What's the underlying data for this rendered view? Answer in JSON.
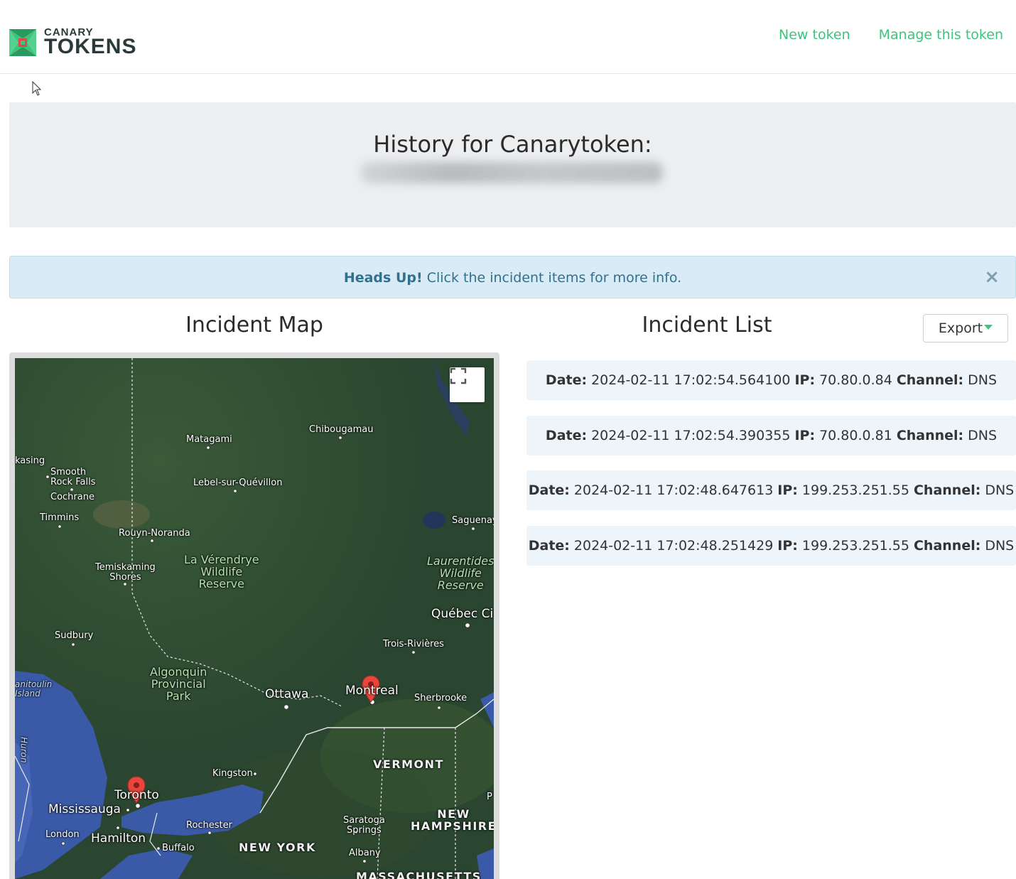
{
  "brand": {
    "small": "CANARY",
    "big": "TOKENS"
  },
  "nav": {
    "new_token": "New token",
    "manage_token": "Manage this token"
  },
  "jumbotron": {
    "title": "History for Canarytoken:"
  },
  "alert": {
    "strong": "Heads Up!",
    "text": "Click the incident items for more info.",
    "close": "×"
  },
  "map_section": {
    "heading": "Incident Map",
    "labels": {
      "kasing": "kasing",
      "smooth": "Smooth\nRock Falls",
      "cochrane": "Cochrane",
      "timmins": "Timmins",
      "matagami": "Matagami",
      "chibougamau": "Chibougamau",
      "lebel": "Lebel-sur-Quévillon",
      "saguenay": "Saguenay",
      "rouyn": "Rouyn-Noranda",
      "laverendrye": "La Vérendrye\nWildlife\nReserve",
      "temiskaming": "Temiskaming\nShores",
      "laurentides": "Laurentides\nWildlife\nReserve",
      "quebec": "Québec Ci",
      "sudbury": "Sudbury",
      "trois": "Trois-Rivières",
      "algonquin": "Algonquin\nProvincial\nPark",
      "manitoulin": "anitoulin\nIsland",
      "ottawa": "Ottawa",
      "montreal": "Montreal",
      "sherbrooke": "Sherbrooke",
      "huron": "Huron",
      "vermont": "VERMONT",
      "kingston": "Kingston",
      "toronto": "Toronto",
      "mississauga": "Mississauga",
      "p": "P",
      "newhampshire": "NEW\nHAMPSHIRE",
      "saratoga": "Saratoga\nSprings",
      "london": "London",
      "hamilton": "Hamilton",
      "rochester": "Rochester",
      "buffalo": "Buffalo",
      "newyork": "NEW YORK",
      "albany": "Albany",
      "massachusetts": "MASSACHUSETTS"
    }
  },
  "list_section": {
    "heading": "Incident List",
    "export_label": "Export",
    "field_labels": {
      "date": "Date:",
      "ip": "IP:",
      "channel": "Channel:"
    },
    "incidents": [
      {
        "date": "2024-02-11 17:02:54.564100",
        "ip": "70.80.0.84",
        "channel": "DNS"
      },
      {
        "date": "2024-02-11 17:02:54.390355",
        "ip": "70.80.0.81",
        "channel": "DNS"
      },
      {
        "date": "2024-02-11 17:02:48.647613",
        "ip": "199.253.251.55",
        "channel": "DNS"
      },
      {
        "date": "2024-02-11 17:02:48.251429",
        "ip": "199.253.251.55",
        "channel": "DNS"
      }
    ]
  },
  "colors": {
    "accent": "#3cc47c",
    "alert_bg": "#d9ecf5",
    "alert_text": "#31708f",
    "incident_bg": "#edf5fb",
    "marker": "#e8453c"
  },
  "icons": {
    "logo": "canary-logo-icon",
    "fullscreen": "fullscreen-icon",
    "marker": "map-marker-icon",
    "cursor": "mouse-cursor-icon"
  }
}
